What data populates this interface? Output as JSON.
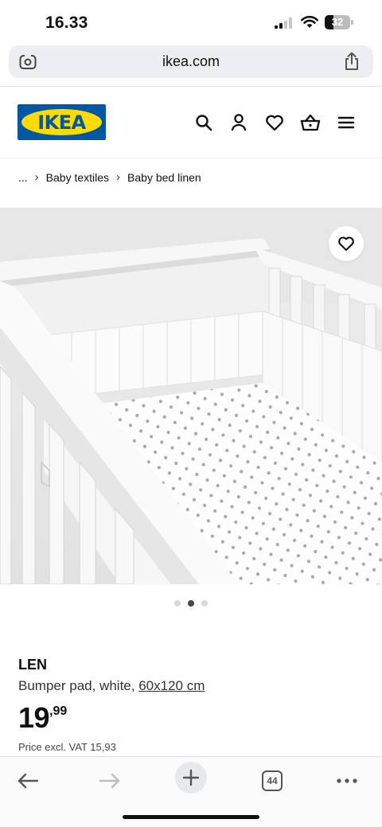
{
  "status_bar": {
    "time": "16.33",
    "battery": "32"
  },
  "browser": {
    "url": "ikea.com",
    "tabs_count": "44"
  },
  "brand": {
    "logo_text": "IKEA",
    "blue": "#0058a3",
    "yellow": "#ffdb00"
  },
  "header_icons": [
    "search-icon",
    "user-icon",
    "heart-icon",
    "basket-icon",
    "menu-icon"
  ],
  "breadcrumb": {
    "ellipsis": "...",
    "items": [
      "Baby textiles",
      "Baby bed linen"
    ]
  },
  "gallery": {
    "slides": 3,
    "active_index": 1
  },
  "product": {
    "name": "LEN",
    "description": "Bumper pad, white,",
    "size": "60x120 cm",
    "price_int": "19",
    "price_dec": ",99",
    "vat_text": "Price excl. VAT 15,93"
  }
}
